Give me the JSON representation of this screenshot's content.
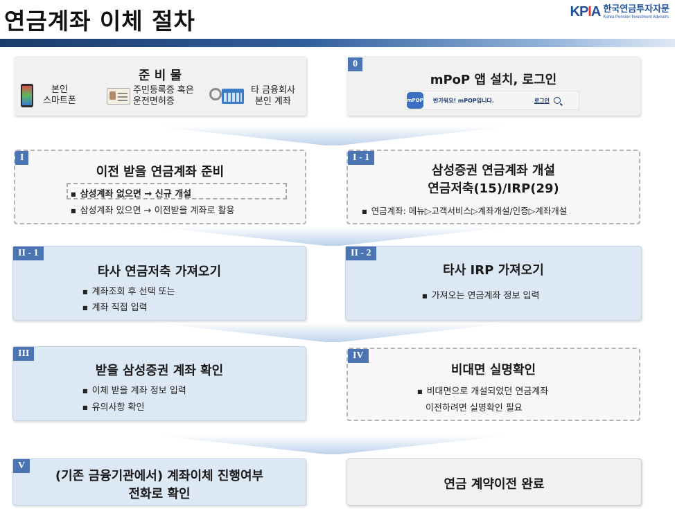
{
  "header": {
    "title": "연금계좌 이체 절차",
    "logo_mark": "KPIA",
    "logo_kr": "한국연금투자자문",
    "logo_en": "Korea Pension Investment Advisors"
  },
  "prep": {
    "title": "준 비 물",
    "items": [
      {
        "line1": "본인",
        "line2": "스마트폰"
      },
      {
        "line1": "주민등록증 혹은",
        "line2": "운전면허증"
      },
      {
        "line1": "타 금융회사",
        "line2": "본인 계좌"
      }
    ]
  },
  "step0": {
    "badge": "0",
    "title": "mPoP 앱 설치, 로그인",
    "app_icon_text": "mPOP",
    "welcome": "반가워요! mPOP입니다.",
    "login": "로그인"
  },
  "step1": {
    "badge": "I",
    "title": "이전 받을 연금계좌 준비",
    "bullets": [
      "삼성계좌 없으면 → 신규 개설",
      "삼성계좌 있으면 → 이전받을 계좌로 활용"
    ]
  },
  "step1_1": {
    "badge": "I - 1",
    "title_line1": "삼성증권 연금계좌 개설",
    "title_line2": "연금저축(15)/IRP(29)",
    "bullet": "연금계좌: 메뉴▷고객서비스▷계좌개설/인증▷계좌개설"
  },
  "step2_1": {
    "badge": "II - 1",
    "title": "타사 연금저축 가져오기",
    "bullets": [
      "계좌조회 후 선택  또는",
      "계좌 직접 입력"
    ]
  },
  "step2_2": {
    "badge": "II - 2",
    "title": "타사 IRP 가져오기",
    "bullet": "가져오는 연금계좌 정보 입력"
  },
  "step3": {
    "badge": "III",
    "title": "받을 삼성증권 계좌 확인",
    "bullets": [
      "이체 받을 계좌 정보 입력",
      "유의사항 확인"
    ]
  },
  "step4": {
    "badge": "IV",
    "title": "비대면 실명확인",
    "line1": "비대면으로 개설되었던 연금계좌",
    "line2": "이전하려면 실명확인 필요"
  },
  "step5": {
    "badge": "V",
    "title_line1": "(기존 금융기관에서) 계좌이체 진행여부",
    "title_line2": "전화로 확인"
  },
  "done": {
    "title": "연금 계약이전 완료"
  }
}
